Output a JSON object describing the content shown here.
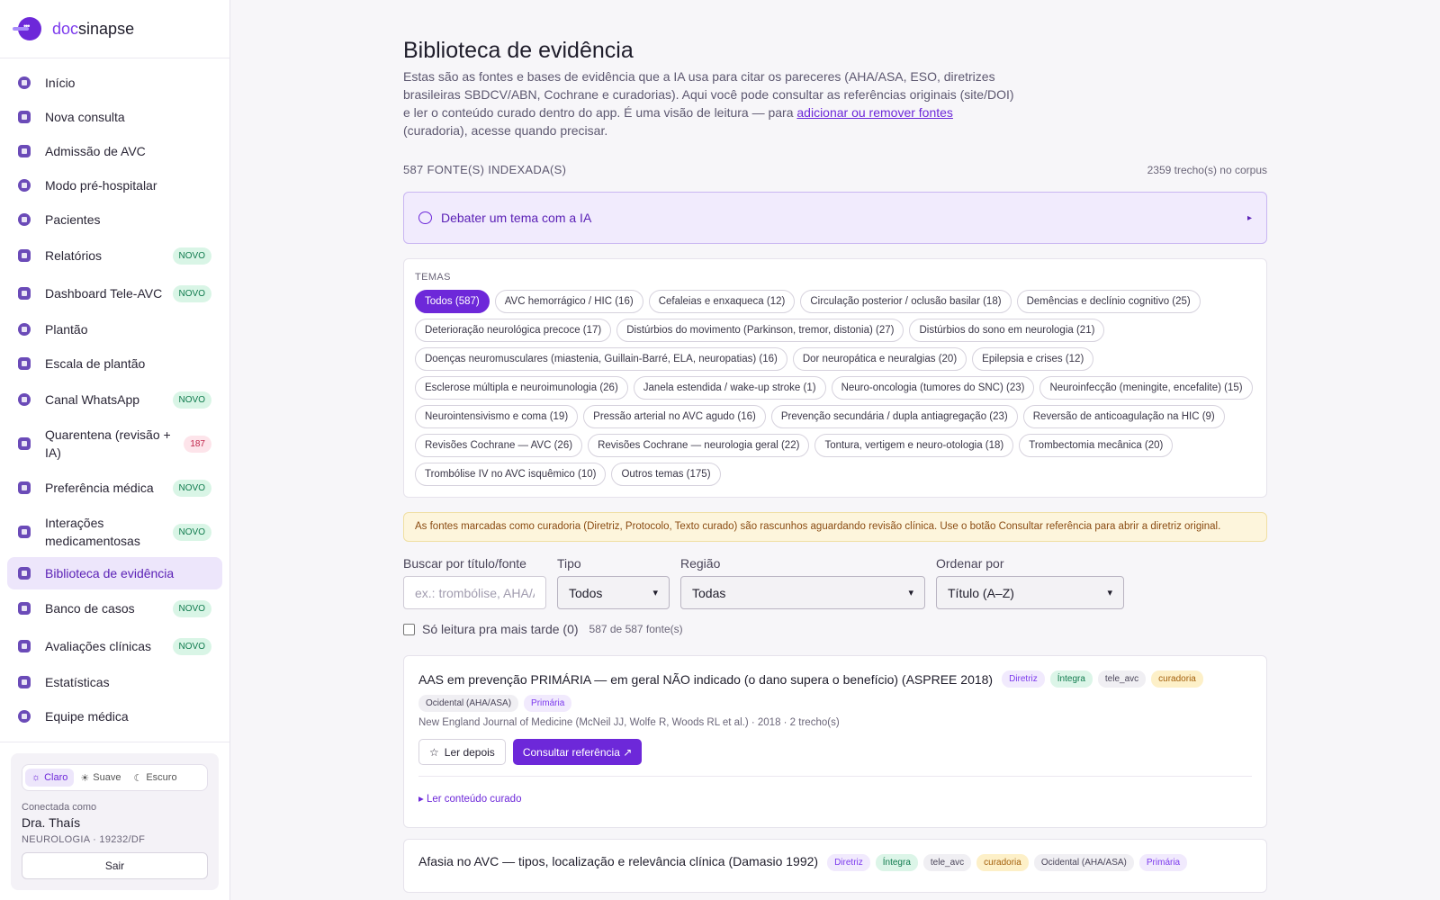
{
  "brand": {
    "prefix": "doc",
    "name": "sinapse"
  },
  "sidebar": {
    "items": [
      {
        "label": "Início",
        "icon": "home-icon"
      },
      {
        "label": "Nova consulta",
        "icon": "plus-icon"
      },
      {
        "label": "Admissão de AVC",
        "icon": "brain-icon"
      },
      {
        "label": "Modo pré-hospitalar",
        "icon": "ambulance-icon"
      },
      {
        "label": "Pacientes",
        "icon": "users-icon"
      },
      {
        "label": "Relatórios",
        "icon": "report-icon",
        "badge": "NOVO"
      },
      {
        "label": "Dashboard Tele-AVC",
        "icon": "chart-icon",
        "badge": "NOVO"
      },
      {
        "label": "Plantão",
        "icon": "shield-icon"
      },
      {
        "label": "Escala de plantão",
        "icon": "calendar-icon"
      },
      {
        "label": "Canal WhatsApp",
        "icon": "whatsapp-icon",
        "badge": "NOVO"
      },
      {
        "label": "Quarentena (revisão + IA)",
        "icon": "quarantine-icon",
        "count": "187"
      },
      {
        "label": "Preferência médica",
        "icon": "star-icon",
        "badge": "NOVO"
      },
      {
        "label": "Interações medicamentosas",
        "icon": "pill-icon",
        "badge": "NOVO"
      },
      {
        "label": "Biblioteca de evidência",
        "icon": "book-icon",
        "active": true
      },
      {
        "label": "Banco de casos",
        "icon": "graduation-icon",
        "badge": "NOVO"
      },
      {
        "label": "Avaliações clínicas",
        "icon": "clipboard-icon",
        "badge": "NOVO"
      },
      {
        "label": "Estatísticas",
        "icon": "stats-icon"
      },
      {
        "label": "Equipe médica",
        "icon": "team-icon"
      }
    ],
    "theme": {
      "light": "Claro",
      "soft": "Suave",
      "dark": "Escuro"
    },
    "user": {
      "connected_as": "Conectada como",
      "name": "Dra. Thaís",
      "spec": "NEUROLOGIA · 19232/DF",
      "logout": "Sair"
    }
  },
  "main": {
    "title": "Biblioteca de evidência",
    "intro_before": "Estas são as fontes e bases de evidência que a IA usa para citar os pareceres (AHA/ASA, ESO, diretrizes brasileiras SBDCV/ABN, Cochrane e curadorias). Aqui você pode consultar as referências originais (site/DOI) e ler o conteúdo curado dentro do app. É uma visão de leitura — para ",
    "intro_link": "adicionar ou remover fontes",
    "intro_after": " (curadoria), acesse quando precisar.",
    "count_label": "587 FONTE(S) INDEXADA(S)",
    "corpus_label": "2359 trecho(s) no corpus",
    "debate_label": "Debater um tema com a IA",
    "debate_arrow": "▸",
    "themes_label": "TEMAS",
    "chips": [
      "Todos (587)",
      "AVC hemorrágico / HIC (16)",
      "Cefaleias e enxaqueca (12)",
      "Circulação posterior / oclusão basilar (18)",
      "Demências e declínio cognitivo (25)",
      "Deterioração neurológica precoce (17)",
      "Distúrbios do movimento (Parkinson, tremor, distonia) (27)",
      "Distúrbios do sono em neurologia (21)",
      "Doenças neuromusculares (miastenia, Guillain-Barré, ELA, neuropatias) (16)",
      "Dor neuropática e neuralgias (20)",
      "Epilepsia e crises (12)",
      "Esclerose múltipla e neuroimunologia (26)",
      "Janela estendida / wake-up stroke (1)",
      "Neuro-oncologia (tumores do SNC) (23)",
      "Neuroinfecção (meningite, encefalite) (15)",
      "Neurointensivismo e coma (19)",
      "Pressão arterial no AVC agudo (16)",
      "Prevenção secundária / dupla antiagregação (23)",
      "Reversão de anticoagulação na HIC (9)",
      "Revisões Cochrane — AVC (26)",
      "Revisões Cochrane — neurologia geral (22)",
      "Tontura, vertigem e neuro-otologia (18)",
      "Trombectomia mecânica (20)",
      "Trombólise IV no AVC isquêmico (10)",
      "Outros temas (175)"
    ],
    "notice": "As fontes marcadas como curadoria (Diretriz, Protocolo, Texto curado) são rascunhos aguardando revisão clínica. Use o botão Consultar referência para abrir a diretriz original.",
    "filters": {
      "search_label": "Buscar por título/fonte",
      "search_placeholder": "ex.: trombólise, AHA/ASA",
      "type_label": "Tipo",
      "type_value": "Todos",
      "region_label": "Região",
      "region_value": "Todas",
      "order_label": "Ordenar por",
      "order_value": "Título (A–Z)"
    },
    "read_later_label": "Só leitura pra mais tarde (0)",
    "results_count": "587 de 587 fonte(s)",
    "cards": [
      {
        "title": "AAS em prevenção PRIMÁRIA — em geral NÃO indicado (o dano supera o benefício) (ASPREE 2018)",
        "tags": [
          "Diretriz",
          "Íntegra",
          "tele_avc",
          "curadoria"
        ],
        "tags2": [
          "Ocidental (AHA/ASA)",
          "Primária"
        ],
        "meta": "New England Journal of Medicine (McNeil JJ, Wolfe R, Woods RL et al.) · 2018 · 2 trecho(s)",
        "read_later": "Ler depois",
        "consult": "Consultar referência ↗",
        "read_curated": "▸ Ler conteúdo curado"
      },
      {
        "title": "Afasia no AVC — tipos, localização e relevância clínica (Damasio 1992)",
        "tags": [
          "Diretriz",
          "Íntegra",
          "tele_avc",
          "curadoria",
          "Ocidental (AHA/ASA)",
          "Primária"
        ]
      }
    ]
  },
  "colors": {
    "accent": "#6d28d9",
    "accent_light": "#ede6fb",
    "novo_bg": "#d9f5e6",
    "notice_bg": "#fdf5dc"
  }
}
